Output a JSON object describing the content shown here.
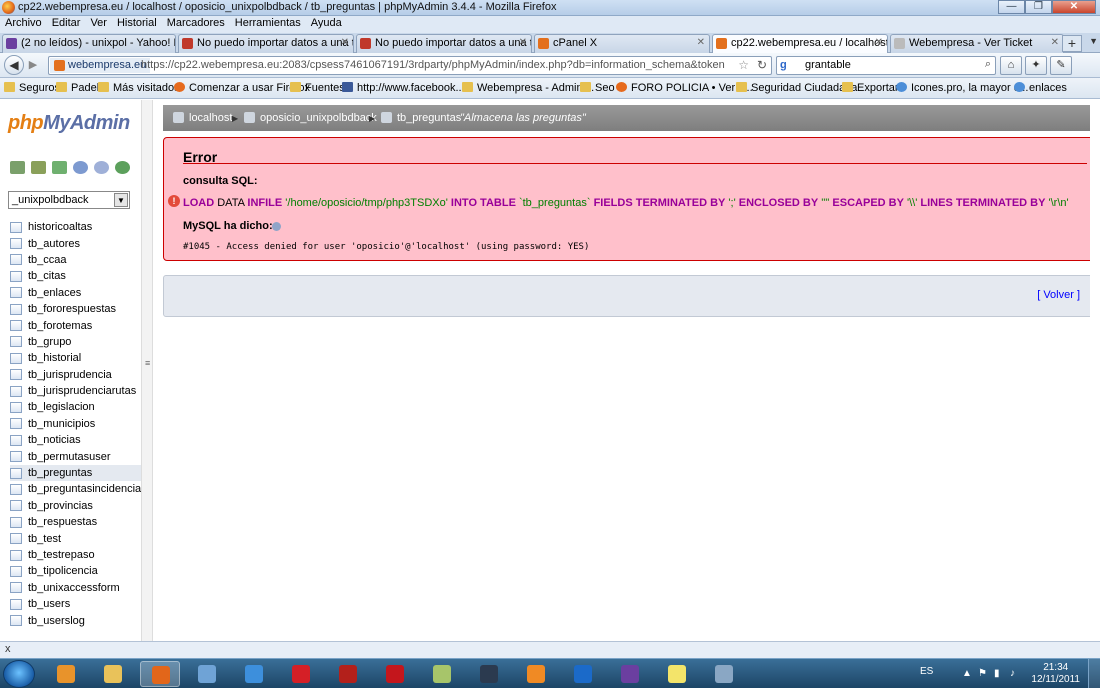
{
  "window": {
    "title": "cp22.webempresa.eu / localhost / oposicio_unixpolbdback / tb_preguntas | phpMyAdmin 3.4.4 - Mozilla Firefox",
    "controls": [
      "—",
      "❐",
      "✕"
    ]
  },
  "menubar": [
    "Archivo",
    "Editar",
    "Ver",
    "Historial",
    "Marcadores",
    "Herramientas",
    "Ayuda"
  ],
  "tabs": [
    {
      "label": "(2 no leídos) - unixpol - Yahoo! Mail",
      "icon_color": "#6b3fa0"
    },
    {
      "label": "No puedo importar datos a una ta...",
      "icon_color": "#c0392b"
    },
    {
      "label": "No puedo importar datos a una ta...",
      "icon_color": "#c0392b"
    },
    {
      "label": "cPanel X",
      "icon_color": "#e3701e"
    },
    {
      "label": "cp22.webempresa.eu / localhost /...",
      "icon_color": "#e3701e"
    },
    {
      "label": "Webempresa - Ver Ticket",
      "icon_color": "#bbbbbb"
    }
  ],
  "active_tab": 4,
  "nav": {
    "site_label": "webempresa.eu",
    "url": "https://cp22.webempresa.eu:2083/cpsess7461067191/3rdparty/phpMyAdmin/index.php?db=information_schema&token=f238b992e8b1e137c29c",
    "search_value": "grantable",
    "search_engine": "g"
  },
  "bookmarks": [
    {
      "label": "Seguros",
      "kind": "folder"
    },
    {
      "label": "Padel",
      "kind": "folder"
    },
    {
      "label": "Más visitados",
      "kind": "folder"
    },
    {
      "label": "Comenzar a usar Firefox",
      "kind": "ff"
    },
    {
      "label": "Fuentes",
      "kind": "folder"
    },
    {
      "label": "http://www.facebook....",
      "kind": "fb"
    },
    {
      "label": "Webempresa - Admini...",
      "kind": "folder"
    },
    {
      "label": "Seo",
      "kind": "folder"
    },
    {
      "label": "FORO POLICIA • Ver T...",
      "kind": "ff"
    },
    {
      "label": "Seguridad Ciudadana",
      "kind": "folder"
    },
    {
      "label": "Exportar",
      "kind": "folder"
    },
    {
      "label": "Icones.pro, la mayor c...",
      "kind": "gl"
    },
    {
      "label": "enlaces",
      "kind": "gl"
    }
  ],
  "sidebar": {
    "logo_php": "php",
    "logo_myadmin": "MyAdmin",
    "db_select": "_unixpolbdback",
    "tables": [
      "historicoaltas",
      "tb_autores",
      "tb_ccaa",
      "tb_citas",
      "tb_enlaces",
      "tb_fororespuestas",
      "tb_forotemas",
      "tb_grupo",
      "tb_historial",
      "tb_jurisprudencia",
      "tb_jurisprudenciarutas",
      "tb_legislacion",
      "tb_municipios",
      "tb_noticias",
      "tb_permutasuser",
      "tb_preguntas",
      "tb_preguntasincidencia",
      "tb_provincias",
      "tb_respuestas",
      "tb_test",
      "tb_testrepaso",
      "tb_tipolicencia",
      "tb_unixaccessform",
      "tb_users",
      "tb_userslog"
    ],
    "selected_table": "tb_preguntas"
  },
  "breadcrumb": {
    "server": "localhost",
    "db": "oposicio_unixpolbdback",
    "table": "tb_preguntas",
    "comment": "\"Almacena las preguntas\""
  },
  "error": {
    "title": "Error",
    "sql_label": "consulta SQL:",
    "sql": {
      "p1": "LOAD",
      "p2": " DATA ",
      "p3": "INFILE",
      "p4": " '/home/oposicio/tmp/php3TSDXo' ",
      "p5": "INTO TABLE",
      "p6": " `tb_preguntas` ",
      "p7": "FIELDS TERMINATED BY",
      "p8": " ';' ",
      "p9": "ENCLOSED BY",
      "p10": " '\"' ",
      "p11": "ESCAPED BY",
      "p12": " '\\\\' ",
      "p13": "LINES TERMINATED BY",
      "p14": " '\\r\\n'"
    },
    "mysql_label": "MySQL ha dicho:",
    "message": "#1045 - Access denied for user 'oposicio'@'localhost' (using password: YES)"
  },
  "volver": "[ Volver ]",
  "status": "x",
  "taskbar": {
    "lang": "ES",
    "time": "21:34",
    "date": "12/11/2011",
    "apps": [
      {
        "name": "media",
        "color": "#e8932b",
        "active": false
      },
      {
        "name": "explorer",
        "color": "#e9c25a",
        "active": false
      },
      {
        "name": "firefox",
        "color": "#e2661a",
        "active": true
      },
      {
        "name": "wave",
        "color": "#6fa3d6",
        "active": false
      },
      {
        "name": "ie",
        "color": "#3d8fdc",
        "active": false
      },
      {
        "name": "opera",
        "color": "#d51f26",
        "active": false
      },
      {
        "name": "filezilla",
        "color": "#b3201b",
        "active": false
      },
      {
        "name": "acrobat",
        "color": "#c4161c",
        "active": false
      },
      {
        "name": "notes",
        "color": "#a7c56a",
        "active": false
      },
      {
        "name": "aftereffects",
        "color": "#2b3a4f",
        "active": false
      },
      {
        "name": "xampp",
        "color": "#f08a24",
        "active": false
      },
      {
        "name": "teamviewer",
        "color": "#1b6ac9",
        "active": false
      },
      {
        "name": "tor",
        "color": "#6b3fa0",
        "active": false
      },
      {
        "name": "mail",
        "color": "#f3e46a",
        "active": false
      },
      {
        "name": "tool",
        "color": "#8aa7c4",
        "active": false
      }
    ]
  }
}
